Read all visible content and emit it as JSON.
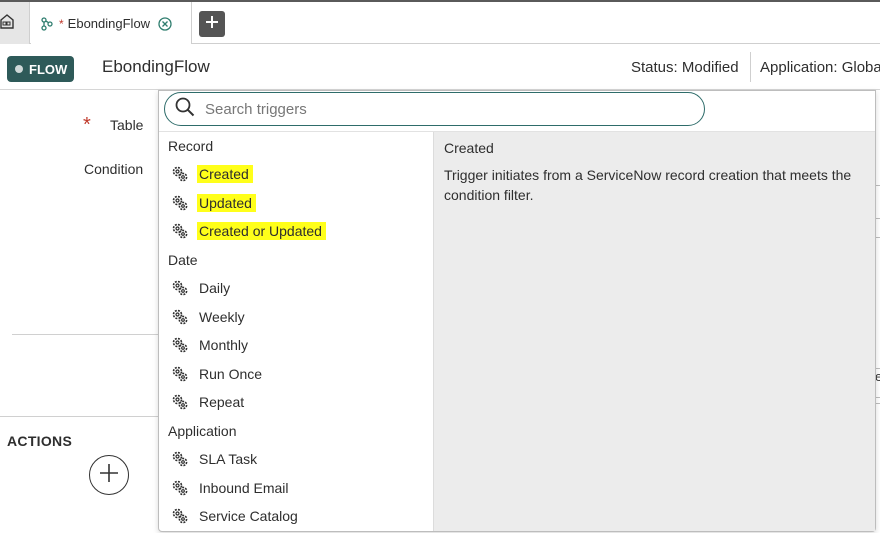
{
  "tabs": {
    "active_title": "EbondingFlow",
    "modified_marker": "*"
  },
  "header": {
    "badge_label": "FLOW",
    "flow_name": "EbondingFlow",
    "status": "Status: Modified",
    "application": "Application: Globa"
  },
  "form": {
    "table_required_marker": "*",
    "table_label": "Table",
    "condition_label": "Condition",
    "actions_label": "ACTIONS",
    "right_edge_text": "e"
  },
  "trigger_picker": {
    "search_placeholder": "Search triggers",
    "groups": [
      {
        "label": "Record",
        "items": [
          {
            "label": "Created",
            "highlighted": true
          },
          {
            "label": "Updated",
            "highlighted": true
          },
          {
            "label": "Created or Updated",
            "highlighted": true
          }
        ]
      },
      {
        "label": "Date",
        "items": [
          {
            "label": "Daily"
          },
          {
            "label": "Weekly"
          },
          {
            "label": "Monthly"
          },
          {
            "label": "Run Once"
          },
          {
            "label": "Repeat"
          }
        ]
      },
      {
        "label": "Application",
        "items": [
          {
            "label": "SLA Task"
          },
          {
            "label": "Inbound Email"
          },
          {
            "label": "Service Catalog"
          }
        ]
      }
    ],
    "detail": {
      "title": "Created",
      "description": "Trigger initiates from a ServiceNow record creation that meets the condition filter."
    }
  },
  "colors": {
    "brand": "#2e5a59",
    "highlight": "#ffff1a",
    "required": "#c0392b",
    "detail_bg": "#ececec"
  },
  "icons": {
    "home": "home-icon",
    "flow": "flow-branch-icon",
    "close": "close-circle-icon",
    "add_tab": "plus-icon",
    "search": "search-icon",
    "trigger": "gears-icon",
    "add_action": "plus-circle-icon"
  }
}
